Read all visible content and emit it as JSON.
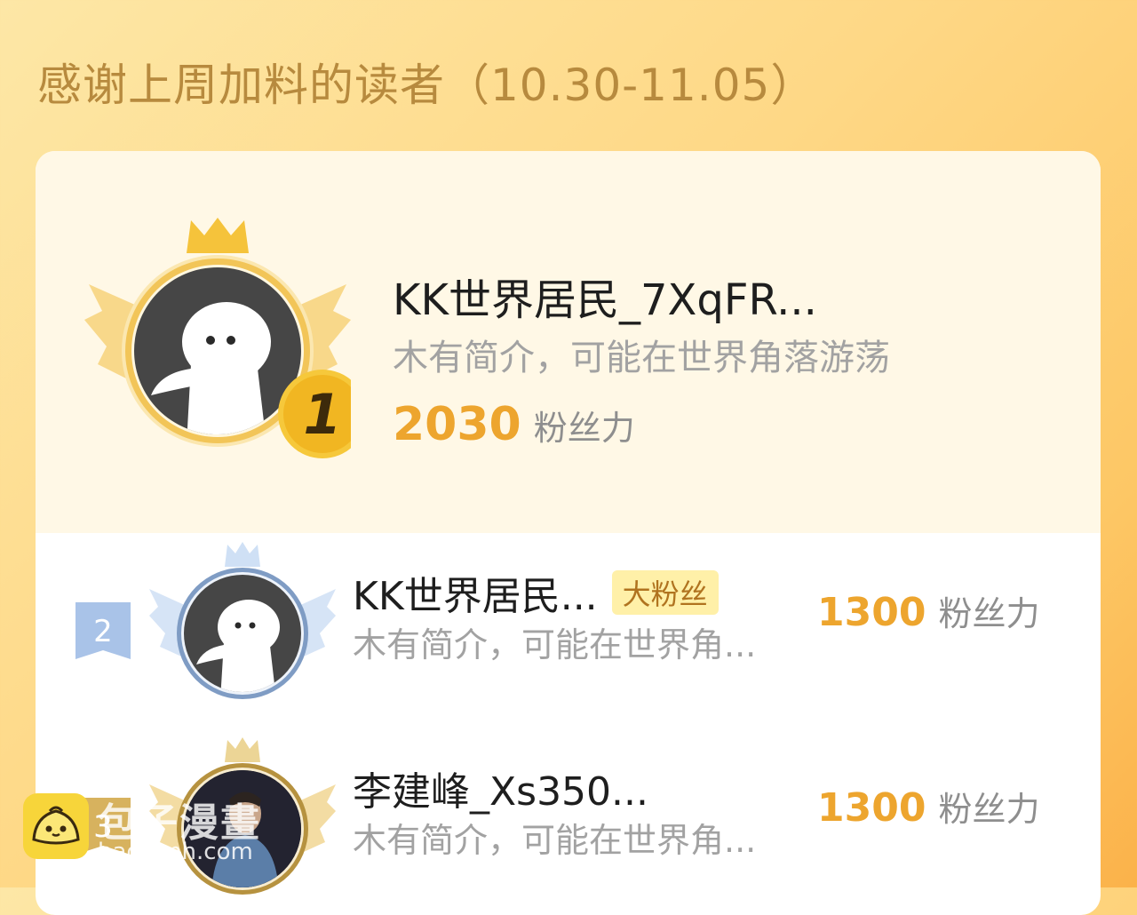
{
  "title": "感谢上周加料的读者（10.30-11.05）",
  "top_reader": {
    "rank": "1",
    "name": "KK世界居民_7XqFR...",
    "bio": "木有简介，可能在世界角落游荡",
    "score": "2030",
    "score_unit": "粉丝力",
    "avatar_icon": "default-avatar-icon"
  },
  "readers": [
    {
      "rank": "2",
      "name": "KK世界居民...",
      "badge": "大粉丝",
      "bio": "木有简介，可能在世界角...",
      "score": "1300",
      "score_unit": "粉丝力",
      "avatar_icon": "default-avatar-icon"
    },
    {
      "rank": "3",
      "name": "李建峰_Xs350...",
      "bio": "木有简介，可能在世界角...",
      "score": "1300",
      "score_unit": "粉丝力",
      "avatar_icon": "user-photo-avatar"
    }
  ],
  "watermark": {
    "name": "包子漫畫",
    "domain": "baozimh.com"
  },
  "colors": {
    "accent": "#eda52e",
    "gold": "#f5c33b",
    "silver": "#a9c3e8",
    "bronze": "#d7b25e"
  }
}
